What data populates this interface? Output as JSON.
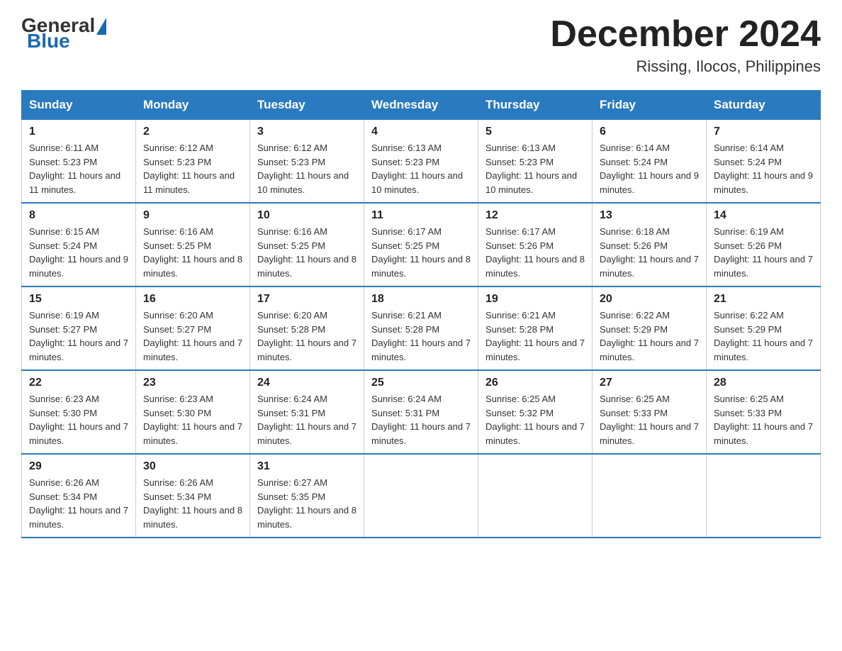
{
  "logo": {
    "general": "General",
    "blue": "Blue"
  },
  "header": {
    "month_year": "December 2024",
    "location": "Rissing, Ilocos, Philippines"
  },
  "days_of_week": [
    "Sunday",
    "Monday",
    "Tuesday",
    "Wednesday",
    "Thursday",
    "Friday",
    "Saturday"
  ],
  "weeks": [
    [
      {
        "day": "1",
        "sunrise": "6:11 AM",
        "sunset": "5:23 PM",
        "daylight": "11 hours and 11 minutes."
      },
      {
        "day": "2",
        "sunrise": "6:12 AM",
        "sunset": "5:23 PM",
        "daylight": "11 hours and 11 minutes."
      },
      {
        "day": "3",
        "sunrise": "6:12 AM",
        "sunset": "5:23 PM",
        "daylight": "11 hours and 10 minutes."
      },
      {
        "day": "4",
        "sunrise": "6:13 AM",
        "sunset": "5:23 PM",
        "daylight": "11 hours and 10 minutes."
      },
      {
        "day": "5",
        "sunrise": "6:13 AM",
        "sunset": "5:23 PM",
        "daylight": "11 hours and 10 minutes."
      },
      {
        "day": "6",
        "sunrise": "6:14 AM",
        "sunset": "5:24 PM",
        "daylight": "11 hours and 9 minutes."
      },
      {
        "day": "7",
        "sunrise": "6:14 AM",
        "sunset": "5:24 PM",
        "daylight": "11 hours and 9 minutes."
      }
    ],
    [
      {
        "day": "8",
        "sunrise": "6:15 AM",
        "sunset": "5:24 PM",
        "daylight": "11 hours and 9 minutes."
      },
      {
        "day": "9",
        "sunrise": "6:16 AM",
        "sunset": "5:25 PM",
        "daylight": "11 hours and 8 minutes."
      },
      {
        "day": "10",
        "sunrise": "6:16 AM",
        "sunset": "5:25 PM",
        "daylight": "11 hours and 8 minutes."
      },
      {
        "day": "11",
        "sunrise": "6:17 AM",
        "sunset": "5:25 PM",
        "daylight": "11 hours and 8 minutes."
      },
      {
        "day": "12",
        "sunrise": "6:17 AM",
        "sunset": "5:26 PM",
        "daylight": "11 hours and 8 minutes."
      },
      {
        "day": "13",
        "sunrise": "6:18 AM",
        "sunset": "5:26 PM",
        "daylight": "11 hours and 7 minutes."
      },
      {
        "day": "14",
        "sunrise": "6:19 AM",
        "sunset": "5:26 PM",
        "daylight": "11 hours and 7 minutes."
      }
    ],
    [
      {
        "day": "15",
        "sunrise": "6:19 AM",
        "sunset": "5:27 PM",
        "daylight": "11 hours and 7 minutes."
      },
      {
        "day": "16",
        "sunrise": "6:20 AM",
        "sunset": "5:27 PM",
        "daylight": "11 hours and 7 minutes."
      },
      {
        "day": "17",
        "sunrise": "6:20 AM",
        "sunset": "5:28 PM",
        "daylight": "11 hours and 7 minutes."
      },
      {
        "day": "18",
        "sunrise": "6:21 AM",
        "sunset": "5:28 PM",
        "daylight": "11 hours and 7 minutes."
      },
      {
        "day": "19",
        "sunrise": "6:21 AM",
        "sunset": "5:28 PM",
        "daylight": "11 hours and 7 minutes."
      },
      {
        "day": "20",
        "sunrise": "6:22 AM",
        "sunset": "5:29 PM",
        "daylight": "11 hours and 7 minutes."
      },
      {
        "day": "21",
        "sunrise": "6:22 AM",
        "sunset": "5:29 PM",
        "daylight": "11 hours and 7 minutes."
      }
    ],
    [
      {
        "day": "22",
        "sunrise": "6:23 AM",
        "sunset": "5:30 PM",
        "daylight": "11 hours and 7 minutes."
      },
      {
        "day": "23",
        "sunrise": "6:23 AM",
        "sunset": "5:30 PM",
        "daylight": "11 hours and 7 minutes."
      },
      {
        "day": "24",
        "sunrise": "6:24 AM",
        "sunset": "5:31 PM",
        "daylight": "11 hours and 7 minutes."
      },
      {
        "day": "25",
        "sunrise": "6:24 AM",
        "sunset": "5:31 PM",
        "daylight": "11 hours and 7 minutes."
      },
      {
        "day": "26",
        "sunrise": "6:25 AM",
        "sunset": "5:32 PM",
        "daylight": "11 hours and 7 minutes."
      },
      {
        "day": "27",
        "sunrise": "6:25 AM",
        "sunset": "5:33 PM",
        "daylight": "11 hours and 7 minutes."
      },
      {
        "day": "28",
        "sunrise": "6:25 AM",
        "sunset": "5:33 PM",
        "daylight": "11 hours and 7 minutes."
      }
    ],
    [
      {
        "day": "29",
        "sunrise": "6:26 AM",
        "sunset": "5:34 PM",
        "daylight": "11 hours and 7 minutes."
      },
      {
        "day": "30",
        "sunrise": "6:26 AM",
        "sunset": "5:34 PM",
        "daylight": "11 hours and 8 minutes."
      },
      {
        "day": "31",
        "sunrise": "6:27 AM",
        "sunset": "5:35 PM",
        "daylight": "11 hours and 8 minutes."
      },
      null,
      null,
      null,
      null
    ]
  ]
}
